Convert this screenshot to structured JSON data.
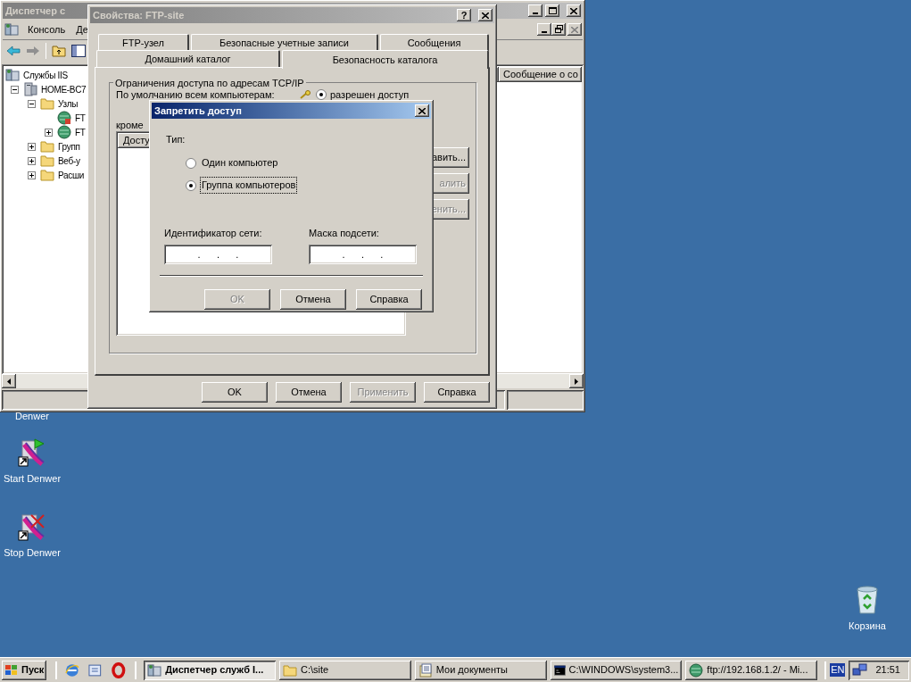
{
  "mmc": {
    "title": "Диспетчер с",
    "menu": [
      "Консоль",
      "Де"
    ],
    "tree": [
      {
        "label": "Службы IIS",
        "kind": "service",
        "children": [
          {
            "label": "HOME-BC7",
            "kind": "server",
            "expanded": true,
            "children": [
              {
                "label": "Узлы",
                "kind": "folder",
                "expanded": true,
                "children": [
                  {
                    "label": "FT",
                    "kind": "stopped-site"
                  },
                  {
                    "label": "FT",
                    "kind": "site",
                    "expanded": false
                  }
                ]
              },
              {
                "label": "Групп",
                "kind": "folder",
                "expanded": false
              },
              {
                "label": "Веб-у",
                "kind": "folder",
                "expanded": false
              },
              {
                "label": "Расши",
                "kind": "folder",
                "expanded": false
              }
            ]
          }
        ]
      }
    ],
    "column_header": "Сообщение о со"
  },
  "properties": {
    "title": "Свойства: FTP-site",
    "help_button": "?",
    "tab_rows": [
      [
        {
          "label": "FTP-узел",
          "selected": false
        },
        {
          "label": "Безопасные учетные записи",
          "selected": false
        },
        {
          "label": "Сообщения",
          "selected": false
        }
      ],
      [
        {
          "label": "Домашний каталог",
          "selected": false
        },
        {
          "label": "Безопасность каталога",
          "selected": true
        }
      ]
    ],
    "group_title": "Ограничения доступа по адресам TCP/IP",
    "default_label": "По умолчанию всем компьютерам:",
    "default_option": {
      "label": "разрешен доступ",
      "selected": true
    },
    "except_label": "кроме",
    "list_header": "Досту",
    "side_buttons": [
      {
        "label": "авить...",
        "disabled": false
      },
      {
        "label": "алить",
        "disabled": true
      },
      {
        "label": "енить...",
        "disabled": true
      }
    ],
    "buttons": [
      {
        "label": "OK",
        "disabled": false
      },
      {
        "label": "Отмена",
        "disabled": false
      },
      {
        "label": "Применить",
        "disabled": true
      },
      {
        "label": "Справка",
        "disabled": false
      }
    ]
  },
  "deny_dialog": {
    "title": "Запретить доступ",
    "type_label": "Тип:",
    "options": [
      {
        "label": "Один компьютер",
        "selected": false,
        "focused": false
      },
      {
        "label": "Группа компьютеров",
        "selected": true,
        "focused": true
      }
    ],
    "fields": [
      {
        "label": "Идентификатор сети:",
        "value": ".      .      ."
      },
      {
        "label": "Маска подсети:",
        "value": ".      .      ."
      }
    ],
    "buttons": [
      {
        "label": "OK",
        "disabled": true
      },
      {
        "label": "Отмена",
        "disabled": false
      },
      {
        "label": "Справка",
        "disabled": false
      }
    ]
  },
  "desktop_icons": [
    {
      "label": "Denwer",
      "kind": "hidden"
    },
    {
      "label": "Start Denwer",
      "kind": "start"
    },
    {
      "label": "Stop Denwer",
      "kind": "stop"
    },
    {
      "label": "Корзина",
      "kind": "recycle"
    }
  ],
  "taskbar": {
    "start": "Пуск",
    "tasks": [
      {
        "label": "Диспетчер служб I...",
        "kind": "mmc",
        "selected": true
      },
      {
        "label": "C:\\site",
        "kind": "folder",
        "selected": false
      },
      {
        "label": "Мои документы",
        "kind": "docs",
        "selected": false
      },
      {
        "label": "C:\\WINDOWS\\system3...",
        "kind": "console",
        "selected": false
      },
      {
        "label": "ftp://192.168.1.2/ - Mi...",
        "kind": "ftp",
        "selected": false
      }
    ],
    "language": "EN",
    "clock": "21:51"
  }
}
